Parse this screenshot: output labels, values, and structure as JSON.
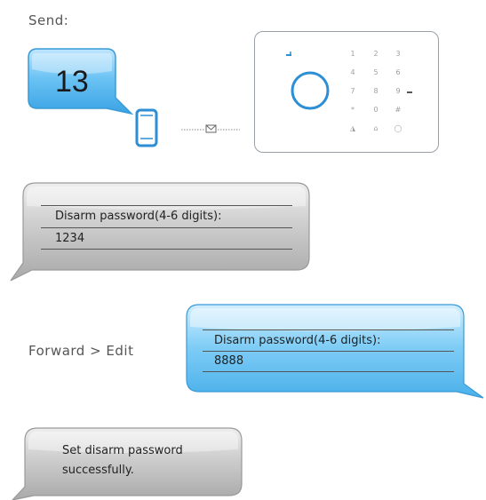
{
  "send_label": "Send:",
  "sms_code": "13",
  "panel_keys": [
    "1",
    "2",
    "3",
    "4",
    "5",
    "6",
    "7",
    "8",
    "9",
    "*",
    "0",
    "#"
  ],
  "reply1": {
    "prompt": "Disarm password(4-6 digits):",
    "value": "1234"
  },
  "forward_label": "Forward > Edit",
  "reply2": {
    "prompt": "Disarm password(4-6 digits):",
    "value": "8888"
  },
  "confirm": {
    "line1": "Set disarm password",
    "line2": "successfully."
  },
  "colors": {
    "blue_bubble": "#5bb8ee",
    "gray_bubble": "#c9c9c9",
    "icon_blue": "#2c8fd6"
  }
}
